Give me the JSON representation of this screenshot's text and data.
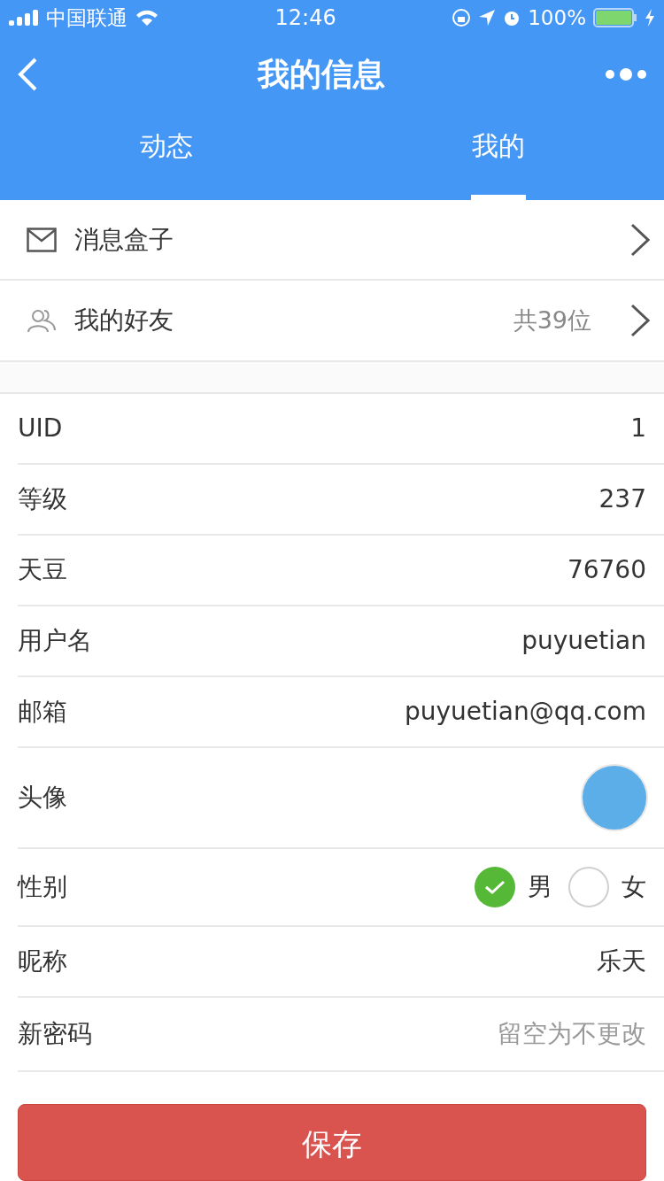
{
  "status_bar": {
    "carrier": "中国联通",
    "time": "12:46",
    "battery": "100%"
  },
  "nav": {
    "title": "我的信息"
  },
  "tabs": [
    {
      "label": "动态",
      "selected": false
    },
    {
      "label": "我的",
      "selected": true
    }
  ],
  "menu": [
    {
      "kind": "mail",
      "label": "消息盒子"
    },
    {
      "kind": "friends",
      "label": "我的好友",
      "count": "共39位"
    }
  ],
  "fields": [
    {
      "kind": "text",
      "label": "UID",
      "value": "1"
    },
    {
      "kind": "text",
      "label": "等级",
      "value": "237"
    },
    {
      "kind": "text",
      "label": "天豆",
      "value": "76760"
    },
    {
      "kind": "text",
      "label": "用户名",
      "value": "puyuetian"
    },
    {
      "kind": "text",
      "label": "邮箱",
      "value": "puyuetian@qq.com"
    },
    {
      "kind": "avatar",
      "label": "头像"
    },
    {
      "kind": "radio",
      "label": "性别",
      "options": [
        {
          "label": "男",
          "selected": true
        },
        {
          "label": "女",
          "selected": false
        }
      ]
    },
    {
      "kind": "text",
      "label": "昵称",
      "value": "乐天"
    },
    {
      "kind": "input",
      "label": "新密码",
      "placeholder": "留空为不更改"
    }
  ],
  "save_button": "保存"
}
